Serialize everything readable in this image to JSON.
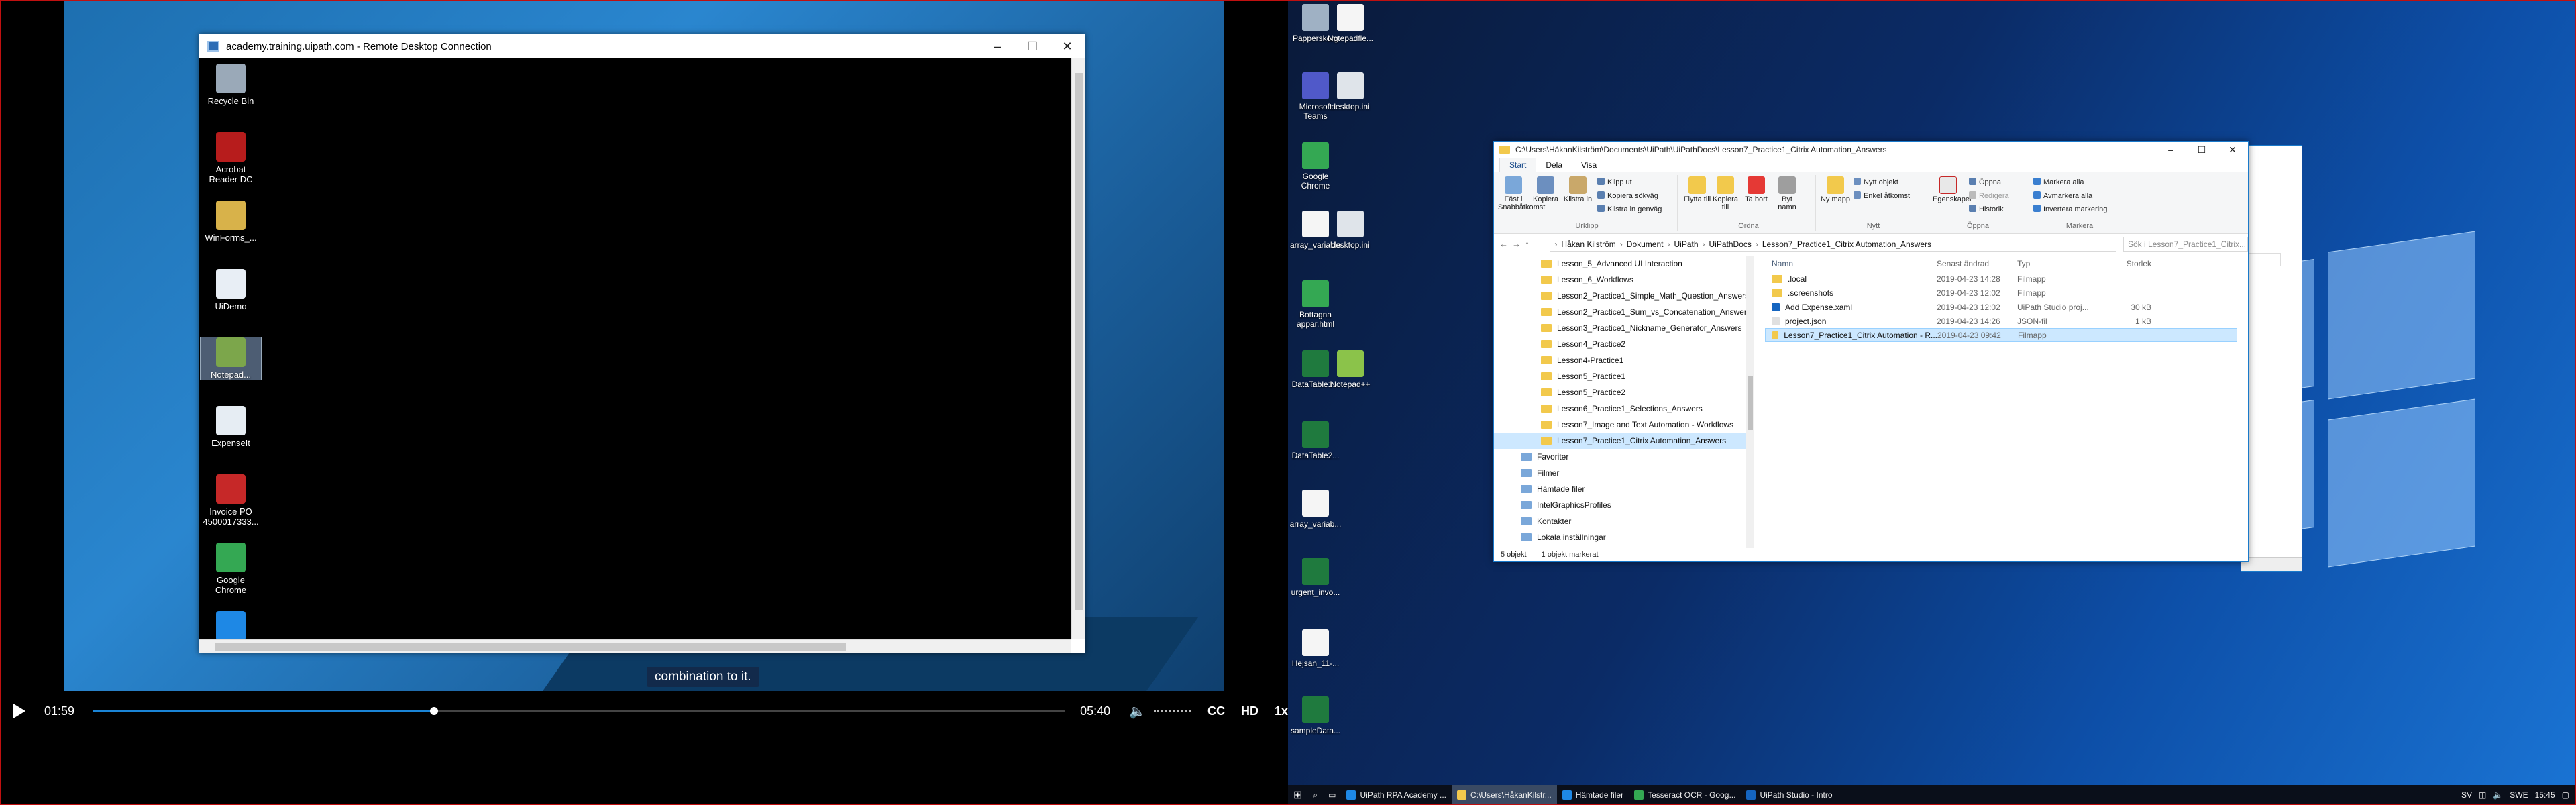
{
  "video": {
    "subtitle": "combination to it.",
    "time_current": "01:59",
    "time_total": "05:40",
    "progress": 0.35,
    "buffered": 0.35,
    "cc_label": "CC",
    "hd_label": "HD",
    "speed_label": "1x"
  },
  "rdp": {
    "title": "academy.training.uipath.com - Remote Desktop Connection",
    "min": "–",
    "max": "☐",
    "close": "✕",
    "icons": [
      {
        "label": "Recycle Bin",
        "color": "#9aa9b8"
      },
      {
        "label": "Acrobat Reader DC",
        "color": "#b71c1c"
      },
      {
        "label": "WinForms_...",
        "color": "#d8b24a"
      },
      {
        "label": "UiDemo",
        "color": "#e8eef5"
      },
      {
        "label": "Notepad...",
        "color": "#7ca64b"
      },
      {
        "label": "ExpenseIt",
        "color": "#e6edf3"
      },
      {
        "label": "Invoice PO 4500017333...",
        "color": "#c62828"
      },
      {
        "label": "Google Chrome",
        "color": "#34a853"
      },
      {
        "label": "",
        "color": "#1e88e5"
      }
    ]
  },
  "desktop_right": {
    "icons": [
      {
        "label": "Papperskorg",
        "color": "#9fb1c4"
      },
      {
        "label": "Notepadfle...",
        "color": "#f5f5f5"
      },
      {
        "label": "Microsoft Teams",
        "color": "#5059c9"
      },
      {
        "label": "desktop.ini",
        "color": "#dfe4ea"
      },
      {
        "label": "Google Chrome",
        "color": "#34a853"
      },
      {
        "label": "array_variable",
        "color": "#f5f5f5"
      },
      {
        "label": "desktop.ini",
        "color": "#dfe4ea"
      },
      {
        "label": "Bottagna appar.html",
        "color": "#34a853"
      },
      {
        "label": "DataTable1...",
        "color": "#1f7a3e"
      },
      {
        "label": "Notepad++",
        "color": "#8bc34a"
      },
      {
        "label": "DataTable2...",
        "color": "#1f7a3e"
      },
      {
        "label": "array_variab...",
        "color": "#f5f5f5"
      },
      {
        "label": "urgent_invo...",
        "color": "#1f7a3e"
      },
      {
        "label": "Hejsan_11-...",
        "color": "#f5f5f5"
      },
      {
        "label": "sampleData...",
        "color": "#1f7a3e"
      }
    ]
  },
  "explorer": {
    "path_title": "C:\\Users\\HåkanKilström\\Documents\\UiPath\\UiPathDocs\\Lesson7_Practice1_Citrix Automation_Answers",
    "tabs": [
      "Start",
      "Dela",
      "Visa"
    ],
    "ribbon": {
      "pin": "Fäst i Snabbåtkomst",
      "copy": "Kopiera",
      "paste": "Klistra in",
      "cut": "Klipp ut",
      "copy_path": "Kopiera sökväg",
      "paste_shortcut": "Klistra in genväg",
      "group_clipboard": "Urklipp",
      "move_to": "Flytta till",
      "copy_to": "Kopiera till",
      "delete": "Ta bort",
      "rename": "Byt namn",
      "new_folder": "Ny mapp",
      "new_item": "Nytt objekt",
      "easy_access": "Enkel åtkomst",
      "group_organize": "Ordna",
      "group_new": "Nytt",
      "properties": "Egenskaper",
      "open": "Öppna",
      "edit": "Redigera",
      "history": "Historik",
      "group_open": "Öppna",
      "select_all": "Markera alla",
      "select_none": "Avmarkera alla",
      "invert": "Invertera markering",
      "group_select": "Markera"
    },
    "breadcrumbs": [
      "Håkan Kilström",
      "Dokument",
      "UiPath",
      "UiPathDocs",
      "Lesson7_Practice1_Citrix Automation_Answers"
    ],
    "search_placeholder": "Sök i Lesson7_Practice1_Citrix...",
    "tree": [
      {
        "label": "Lesson_5_Advanced UI Interaction",
        "type": "folder"
      },
      {
        "label": "Lesson_6_Workflows",
        "type": "folder"
      },
      {
        "label": "Lesson2_Practice1_Simple_Math_Question_Answers",
        "type": "folder"
      },
      {
        "label": "Lesson2_Practice1_Sum_vs_Concatenation_Answers",
        "type": "folder"
      },
      {
        "label": "Lesson3_Practice1_Nickname_Generator_Answers",
        "type": "folder"
      },
      {
        "label": "Lesson4_Practice2",
        "type": "folder"
      },
      {
        "label": "Lesson4-Practice1",
        "type": "folder"
      },
      {
        "label": "Lesson5_Practice1",
        "type": "folder"
      },
      {
        "label": "Lesson5_Practice2",
        "type": "folder"
      },
      {
        "label": "Lesson6_Practice1_Selections_Answers",
        "type": "folder"
      },
      {
        "label": "Lesson7_Image and Text Automation - Workflows",
        "type": "folder"
      },
      {
        "label": "Lesson7_Practice1_Citrix Automation_Answers",
        "type": "folder",
        "selected": true
      },
      {
        "label": "Favoriter",
        "type": "lib"
      },
      {
        "label": "Filmer",
        "type": "lib"
      },
      {
        "label": "Hämtade filer",
        "type": "lib"
      },
      {
        "label": "IntelGraphicsProfiles",
        "type": "lib"
      },
      {
        "label": "Kontakter",
        "type": "lib"
      },
      {
        "label": "Lokala inställningar",
        "type": "lib"
      }
    ],
    "columns": [
      "Namn",
      "Senast ändrad",
      "Typ",
      "Storlek"
    ],
    "files": [
      {
        "name": ".local",
        "date": "2019-04-23 14:28",
        "type": "Filmapp",
        "size": "",
        "icon": "folder"
      },
      {
        "name": ".screenshots",
        "date": "2019-04-23 12:02",
        "type": "Filmapp",
        "size": "",
        "icon": "folder"
      },
      {
        "name": "Add Expense.xaml",
        "date": "2019-04-23 12:02",
        "type": "UiPath Studio proj...",
        "size": "30 kB",
        "icon": "xaml"
      },
      {
        "name": "project.json",
        "date": "2019-04-23 14:26",
        "type": "JSON-fil",
        "size": "1 kB",
        "icon": "file"
      },
      {
        "name": "Lesson7_Practice1_Citrix Automation - R...",
        "date": "2019-04-23 09:42",
        "type": "Filmapp",
        "size": "",
        "icon": "folder",
        "selected": true
      }
    ],
    "status_count": "5 objekt",
    "status_selected": "1 objekt markerat"
  },
  "taskbar": {
    "items": [
      {
        "label": "UiPath RPA Academy ...",
        "color": "#1e88e5",
        "active": false
      },
      {
        "label": "C:\\Users\\HåkanKilstr...",
        "color": "#f2c94c",
        "active": true
      },
      {
        "label": "Hämtade filer",
        "color": "#1e88e5",
        "active": false
      },
      {
        "label": "Tesseract OCR - Goog...",
        "color": "#34a853",
        "active": false
      },
      {
        "label": "UiPath Studio - Intro",
        "color": "#1565c0",
        "active": false
      }
    ],
    "lang": "SV",
    "lang2": "SWE",
    "time": "15:45"
  }
}
